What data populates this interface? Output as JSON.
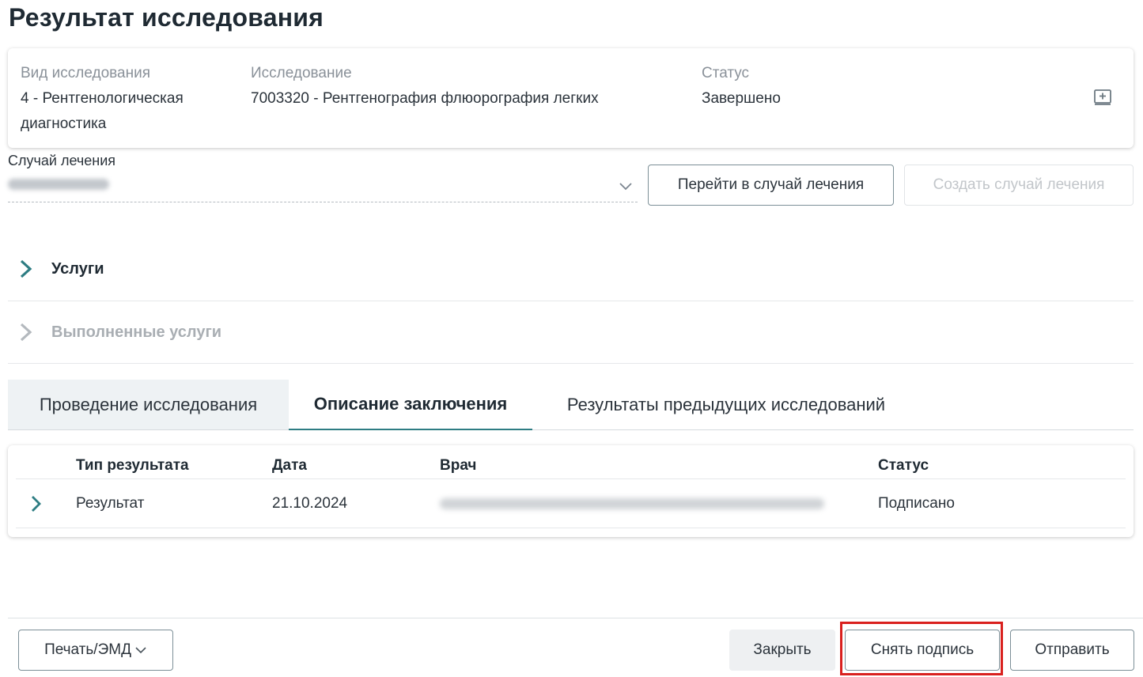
{
  "page": {
    "title": "Результат исследования"
  },
  "info": {
    "type_label": "Вид исследования",
    "type_value": "4 - Рентгенологическая диагностика",
    "study_label": "Исследование",
    "study_value": "7003320 - Рентгенография флюорография легких",
    "status_label": "Статус",
    "status_value": "Завершено",
    "icon": "image-add-icon"
  },
  "case": {
    "label": "Случай лечения",
    "goto_button": "Перейти в случай лечения",
    "create_button": "Создать случай лечения"
  },
  "sections": {
    "services": "Услуги",
    "done_services": "Выполненные услуги"
  },
  "tabs": [
    {
      "label": "Проведение исследования"
    },
    {
      "label": "Описание заключения",
      "active": true
    },
    {
      "label": "Результаты предыдущих исследований"
    }
  ],
  "results_table": {
    "columns": [
      "Тип результата",
      "Дата",
      "Врач",
      "Статус"
    ],
    "rows": [
      {
        "type": "Результат",
        "date": "21.10.2024",
        "status": "Подписано"
      }
    ]
  },
  "footer": {
    "print_button": "Печать/ЭМД",
    "close_button": "Закрыть",
    "unsign_button": "Снять подпись",
    "send_button": "Отправить"
  },
  "colors": {
    "accent": "#2e7d83",
    "highlight": "#d9201e"
  }
}
